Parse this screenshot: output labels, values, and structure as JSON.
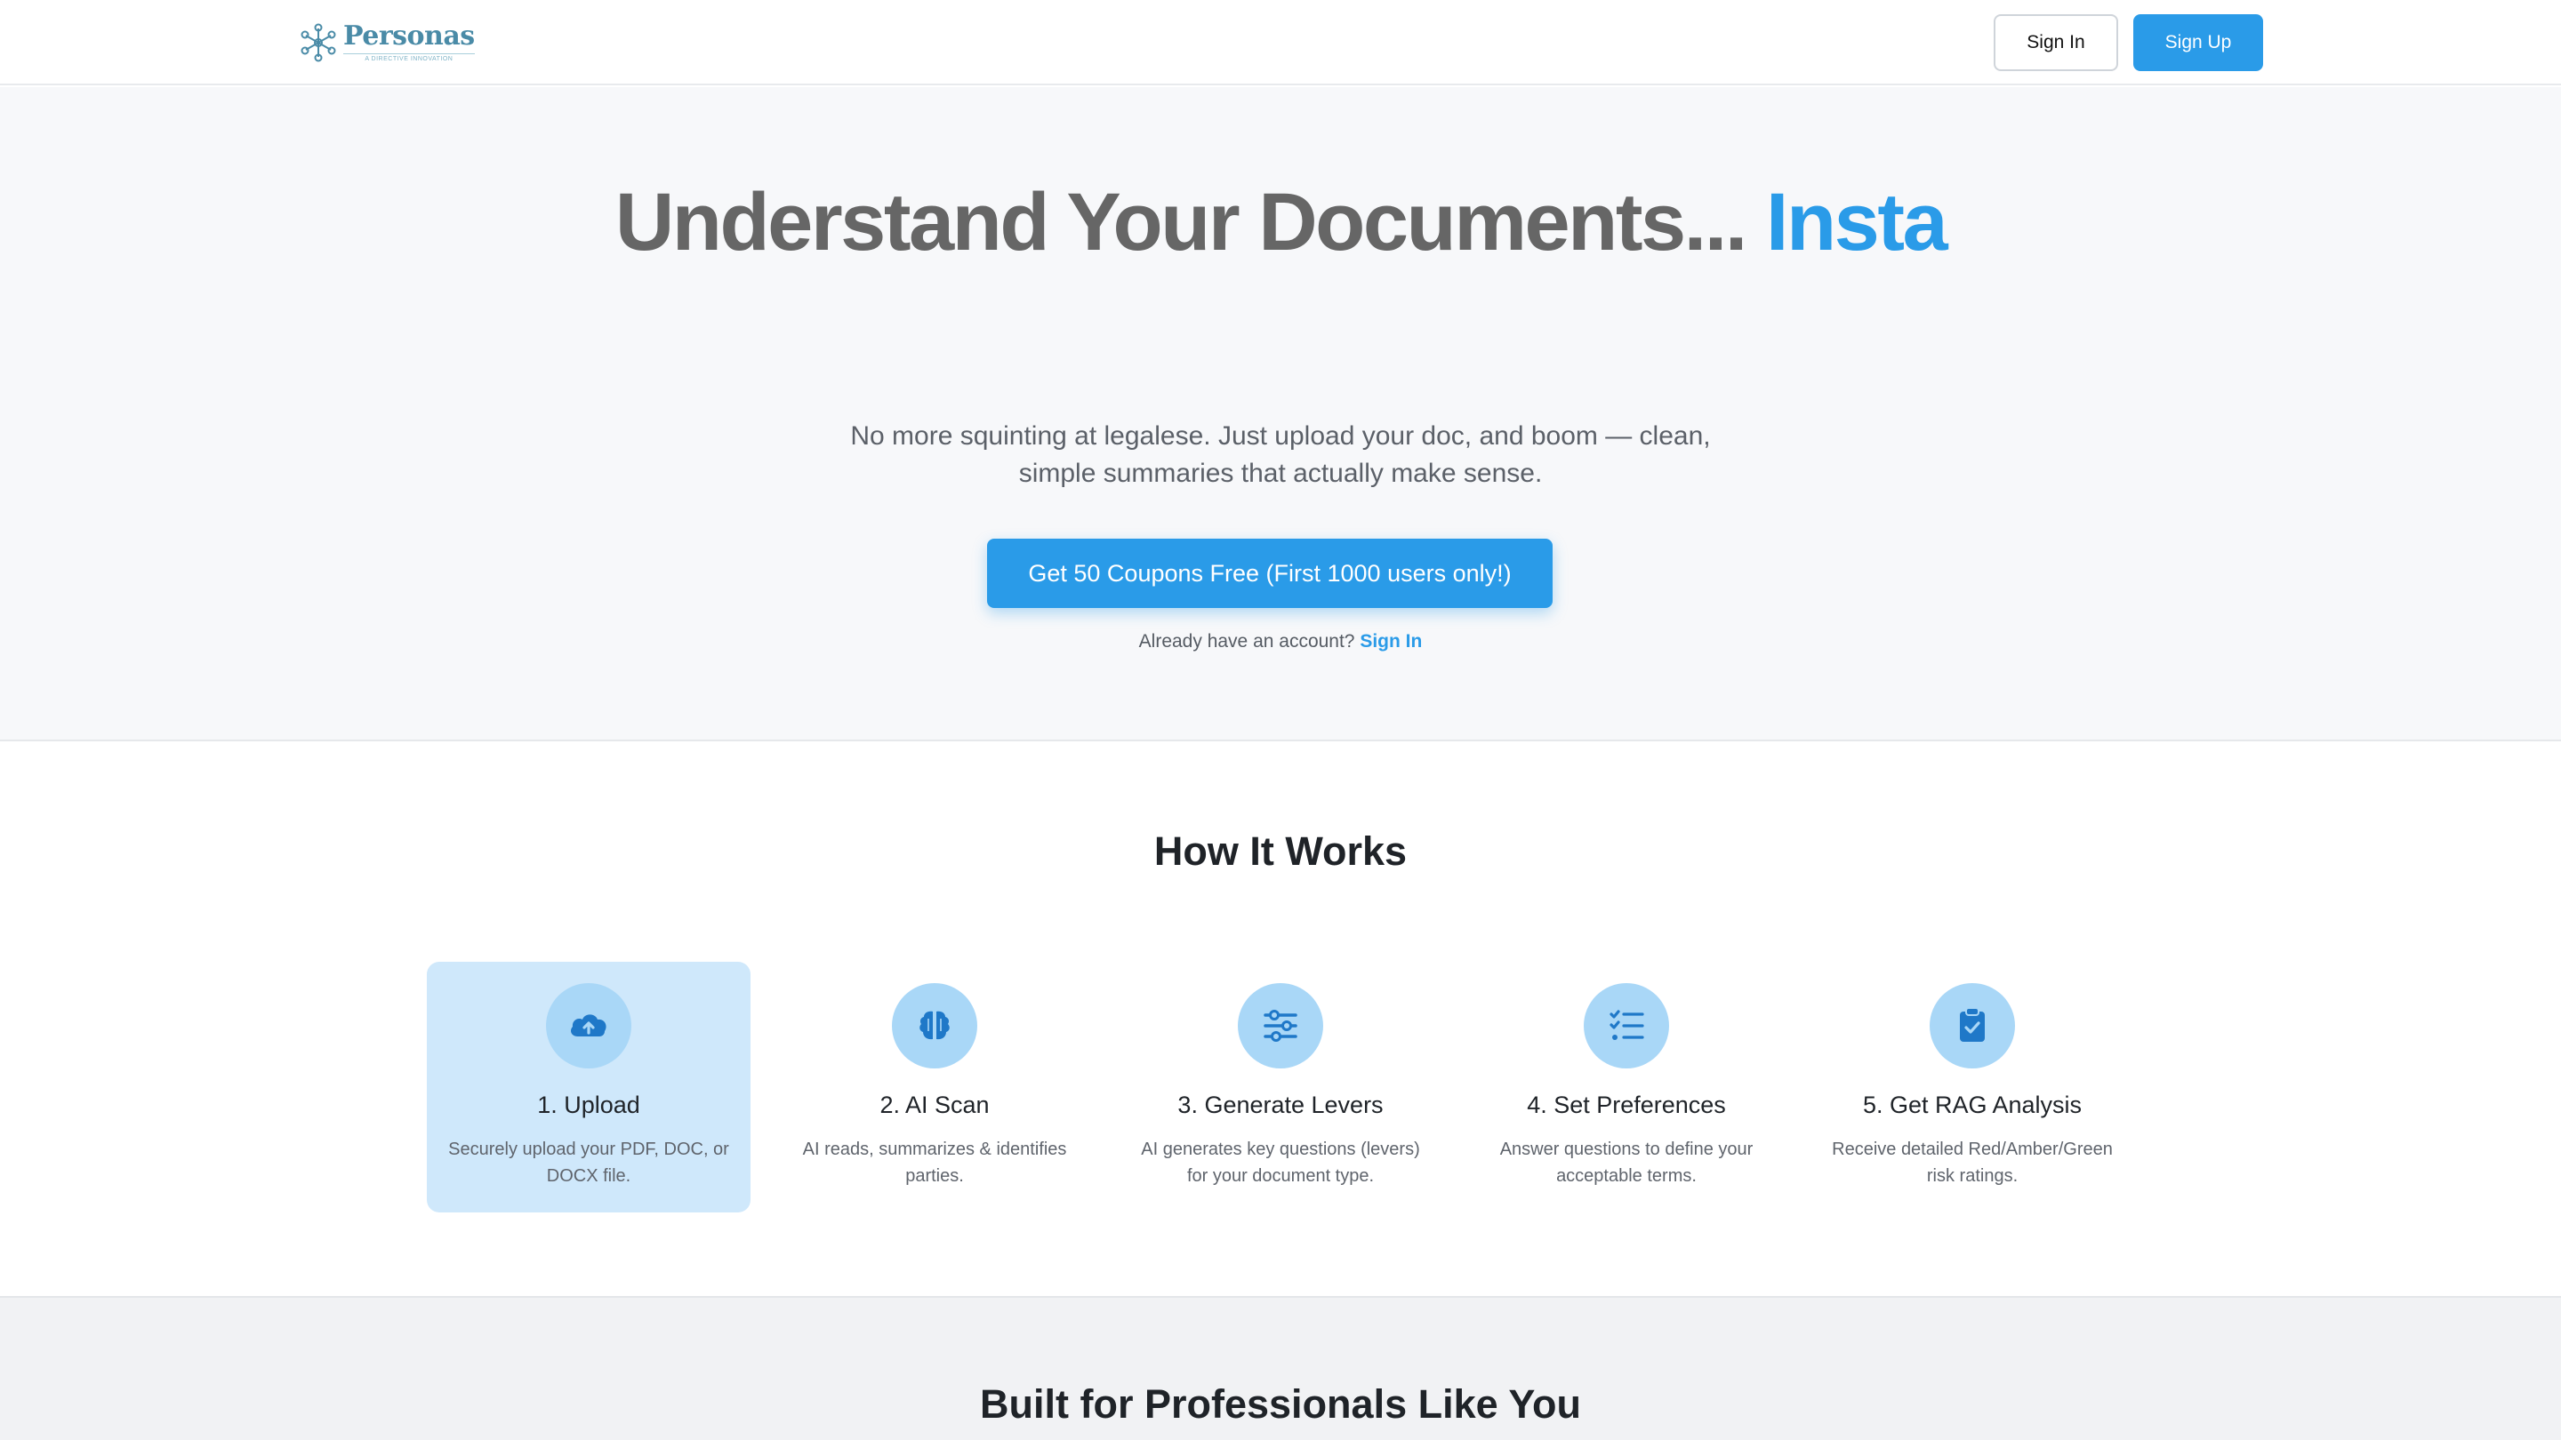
{
  "header": {
    "logo_name": "Personas",
    "logo_tagline": "A DIRECTIVE INNOVATION",
    "signin_label": "Sign In",
    "signup_label": "Sign Up"
  },
  "hero": {
    "title_main": "Understand Your Documents...",
    "title_accent": "Insta",
    "subtitle": "No more squinting at legalese. Just upload your doc, and boom — clean, simple summaries that actually make sense.",
    "cta_label": "Get 50 Coupons Free (First 1000 users only!)",
    "account_prompt": "Already have an account?",
    "account_link": "Sign In"
  },
  "how_it_works": {
    "title": "How It Works",
    "steps": [
      {
        "title": "1. Upload",
        "desc": "Securely upload your PDF, DOC, or DOCX file.",
        "icon": "cloud-upload-icon"
      },
      {
        "title": "2. AI Scan",
        "desc": "AI reads, summarizes & identifies parties.",
        "icon": "brain-icon"
      },
      {
        "title": "3. Generate Levers",
        "desc": "AI generates key questions (levers) for your document type.",
        "icon": "sliders-icon"
      },
      {
        "title": "4. Set Preferences",
        "desc": "Answer questions to define your acceptable terms.",
        "icon": "checklist-icon"
      },
      {
        "title": "5. Get RAG Analysis",
        "desc": "Receive detailed Red/Amber/Green risk ratings.",
        "icon": "clipboard-check-icon"
      }
    ]
  },
  "professionals": {
    "title": "Built for Professionals Like You"
  },
  "colors": {
    "accent": "#2a9be8",
    "icon_circle": "#a9d7f7",
    "icon_fill": "#1f78c8",
    "active_step_bg": "#cfe8fb"
  }
}
